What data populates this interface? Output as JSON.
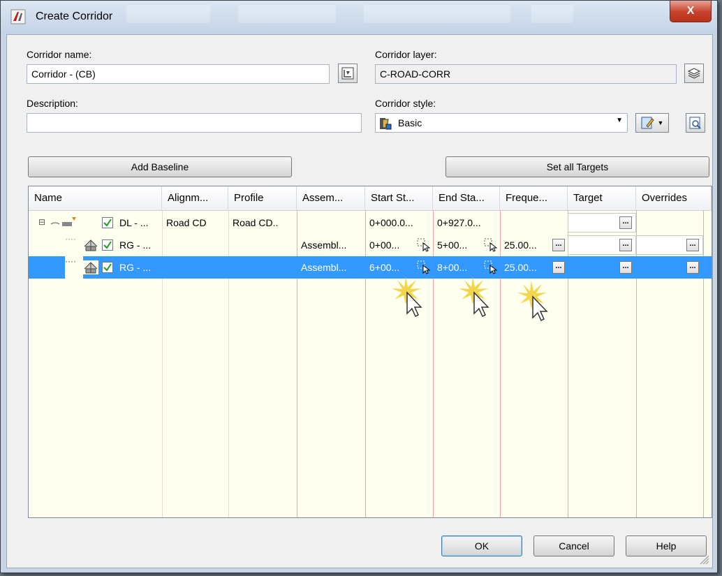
{
  "window": {
    "title": "Create Corridor",
    "close_label": "X"
  },
  "form": {
    "corridor_name_label": "Corridor name:",
    "corridor_name_value": "Corridor - (CB)",
    "description_label": "Description:",
    "description_value": "",
    "corridor_layer_label": "Corridor layer:",
    "corridor_layer_value": "C-ROAD-CORR",
    "corridor_style_label": "Corridor style:",
    "corridor_style_value": "Basic"
  },
  "buttons": {
    "add_baseline": "Add Baseline",
    "set_all_targets": "Set all Targets",
    "ok": "OK",
    "cancel": "Cancel",
    "help": "Help"
  },
  "grid": {
    "columns": [
      "Name",
      "Alignm...",
      "Profile",
      "Assem...",
      "Start St...",
      "End Sta...",
      "Freque...",
      "Target",
      "Overrides"
    ],
    "rows": [
      {
        "name": "DL - ...",
        "alignment": "Road CD",
        "profile": "Road CD..",
        "assembly": "",
        "start": "0+000.0...",
        "end": "0+927.0...",
        "frequency": ""
      },
      {
        "name": "RG - ...",
        "alignment": "",
        "profile": "",
        "assembly": "Assembl...",
        "start": "0+00...",
        "end": "5+00...",
        "frequency": "25.00..."
      },
      {
        "name": "RG - ...",
        "alignment": "",
        "profile": "",
        "assembly": "Assembl...",
        "start": "6+00...",
        "end": "8+00...",
        "frequency": "25.00..."
      }
    ],
    "ellipsis": "..."
  },
  "colors": {
    "selection": "#3399ff",
    "grid_background": "#fffff0",
    "column_divider_red": "#f3a6a6",
    "check_green": "#1e9c1e"
  }
}
